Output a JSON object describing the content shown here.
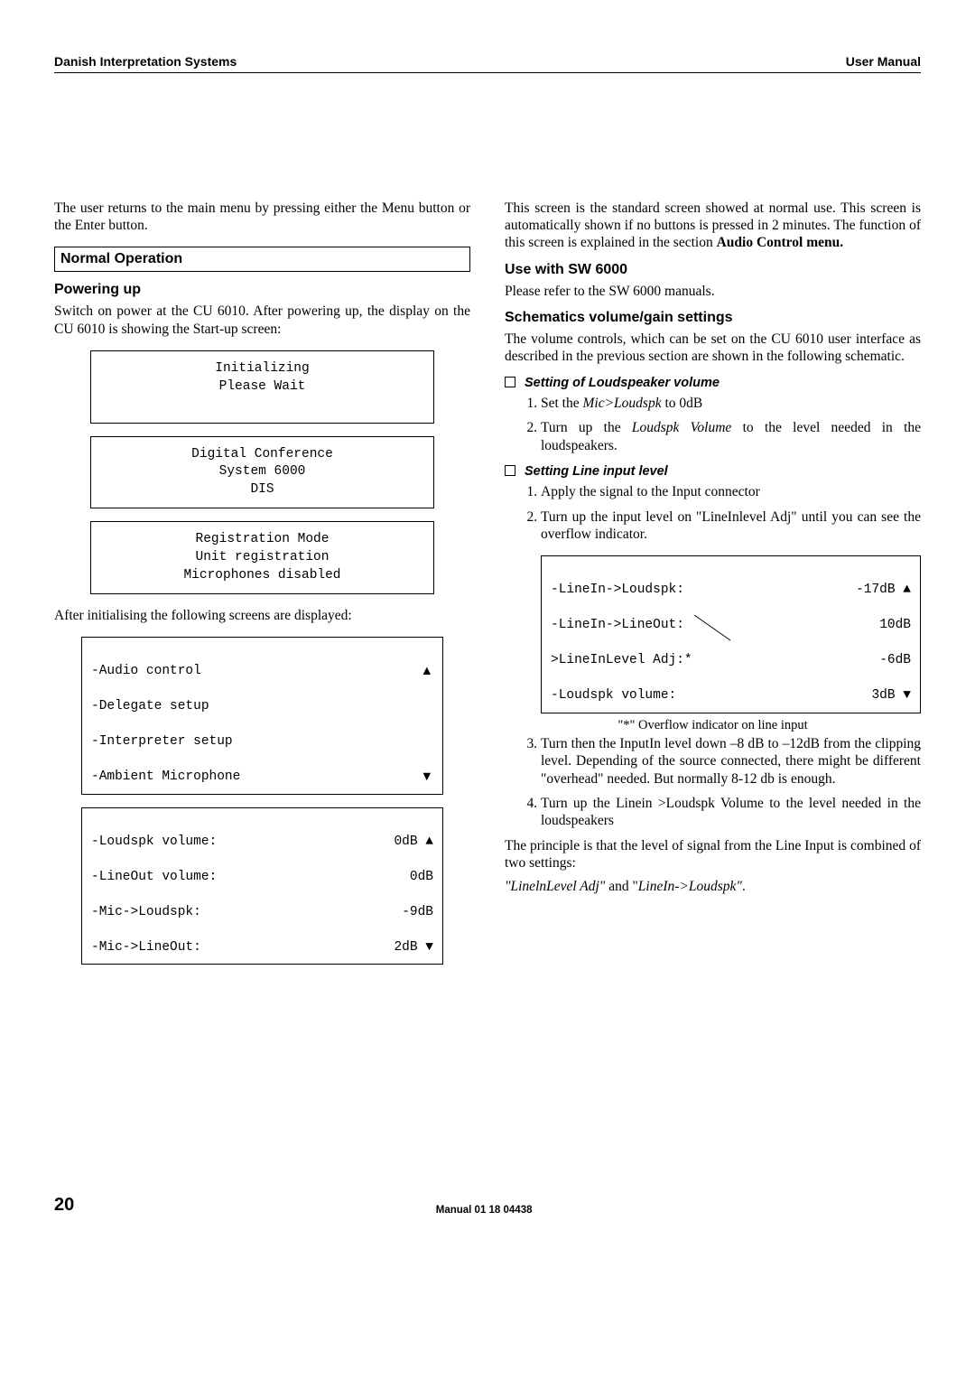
{
  "header": {
    "left": "Danish Interpretation Systems",
    "right": "User Manual"
  },
  "left": {
    "intro": "The user returns to the main menu by pressing either the Menu button or the Enter button.",
    "section": "Normal Operation",
    "h_power": "Powering up",
    "power_para": "Switch on power at the CU 6010. After powering up, the display on the CU 6010 is showing the Start-up screen:",
    "box1": "Initializing\nPlease Wait\n ",
    "box2": "Digital Conference\nSystem 6000\nDIS",
    "box3": "Registration Mode\nUnit registration\nMicrophones disabled",
    "after_init": "After initialising the following screens are displayed:",
    "menu_items": [
      {
        "l": "-Audio control",
        "r": "▲"
      },
      {
        "l": "-Delegate setup",
        "r": ""
      },
      {
        "l": "-Interpreter setup",
        "r": ""
      },
      {
        "l": "-Ambient Microphone",
        "r": "▼"
      }
    ],
    "vol_items": [
      {
        "l": "-Loudspk volume:",
        "r": "0dB ▲"
      },
      {
        "l": "-LineOut volume:",
        "r": "0dB"
      },
      {
        "l": "-Mic->Loudspk:",
        "r": "-9dB"
      },
      {
        "l": "-Mic->LineOut:",
        "r": "2dB ▼"
      }
    ]
  },
  "right": {
    "std_para": "This screen is the standard screen showed at normal use. This screen is automatically shown if no buttons is pressed in 2 minutes. The function of this screen is explained in the section ",
    "std_bold": "Audio Control menu.",
    "h_sw": "Use with SW 6000",
    "sw_para": "Please refer to the SW 6000 manuals.",
    "h_schem": "Schematics volume/gain settings",
    "schem_para": "The volume controls, which can be set on the CU 6010 user interface as described in the previous section are shown in the following schematic.",
    "loud_title": "Setting of Loudspeaker volume",
    "loud_steps": [
      {
        "pre": "Set the ",
        "it": "Mic>Loudspk",
        "post": " to 0dB"
      },
      {
        "pre": "Turn up the ",
        "it": "Loudspk Volume",
        "post": " to the level needed in the loudspeakers."
      }
    ],
    "line_title": "Setting Line input level",
    "line_step1": "Apply the signal to the Input connector",
    "line_step2": "Turn up the input level on \"LineInlevel Adj\" until you can see the overflow indicator.",
    "line_items": [
      {
        "l": "-LineIn->Loudspk:",
        "r": "-17dB ▲"
      },
      {
        "l": "-LineIn->LineOut:",
        "r": "10dB"
      },
      {
        "l": ">LineInLevel Adj:*",
        "r": "-6dB"
      },
      {
        "l": "-Loudspk volume:",
        "r": "3dB ▼"
      }
    ],
    "annot": "\"*\" Overflow indicator on line input",
    "line_step3": "Turn then the InputIn level down –8 dB to –12dB from the clipping level. Depending of the source connected, there might be different \"overhead\" needed. But normally 8-12 db is enough.",
    "line_step4": "Turn up the Linein >Loudspk Volume to the level needed in the loudspeakers",
    "principle": "The principle is that the level of signal from the Line Input is combined of two settings:",
    "princ_it1": "\"LinelnLevel Adj\"",
    "princ_mid": " and \"",
    "princ_it2": "LineIn->Loudspk\"",
    "princ_end": "."
  },
  "footer": {
    "page": "20",
    "mid": "Manual 01 18 04438"
  }
}
